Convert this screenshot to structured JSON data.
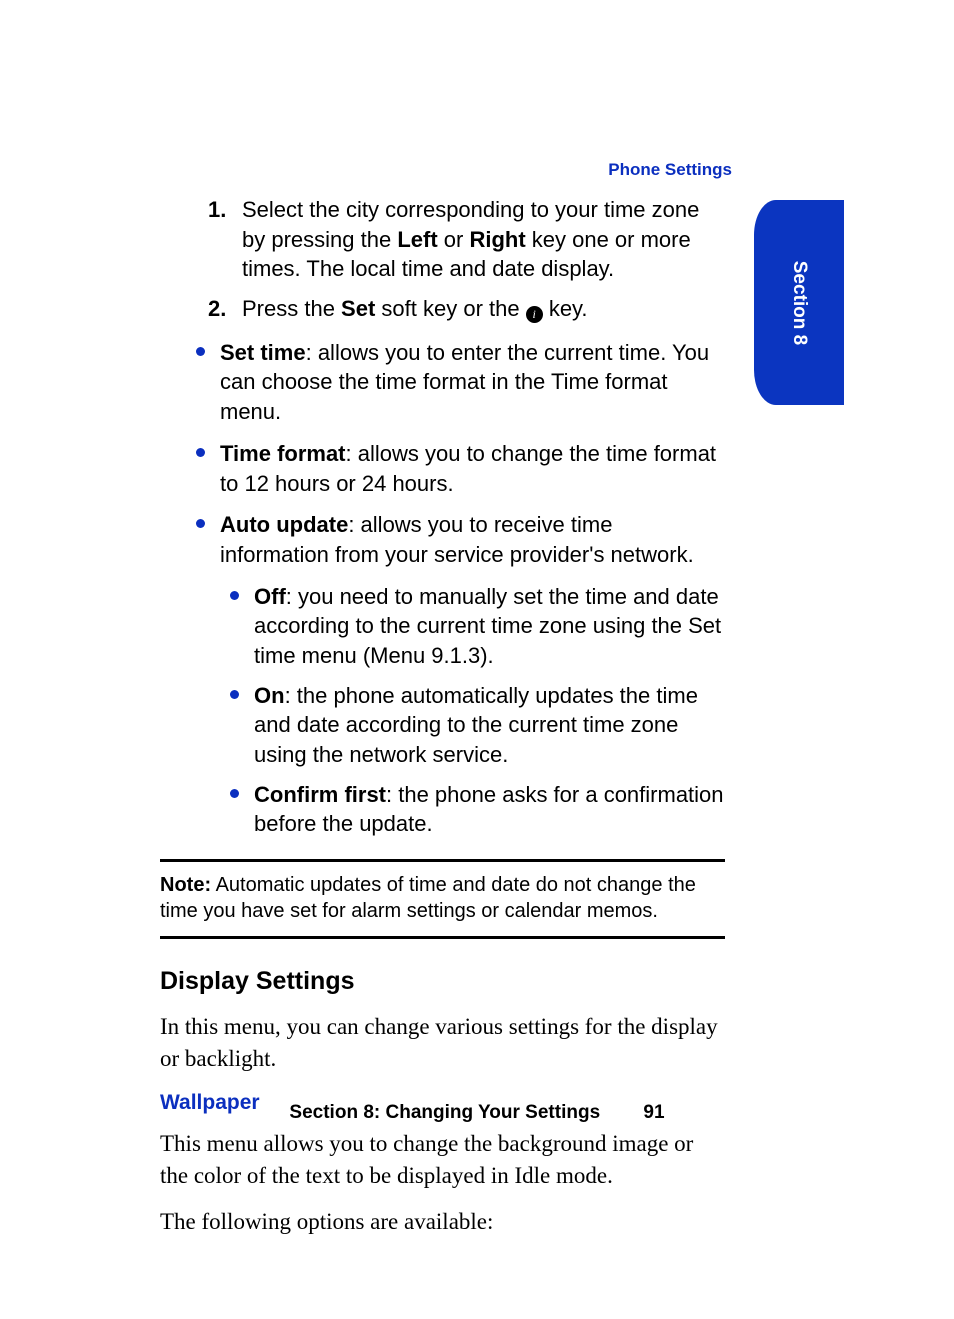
{
  "header": {
    "running_title": "Phone Settings"
  },
  "tab": {
    "label": "Section 8"
  },
  "steps": [
    {
      "marker": "1.",
      "pre": "Select the city corresponding to your time zone by pressing the ",
      "bold1": "Left",
      "mid": " or ",
      "bold2": "Right",
      "post": " key one or more times. The local time and date display."
    },
    {
      "marker": "2.",
      "pre": "Press the ",
      "bold1": "Set",
      "mid": " soft key or the ",
      "icon": "i",
      "post": " key."
    }
  ],
  "bullets": [
    {
      "bold": "Set time",
      "text": ": allows you to enter the current time. You can choose the time format in the Time format menu."
    },
    {
      "bold": "Time format",
      "text": ": allows you to change the time format to 12 hours or 24 hours."
    },
    {
      "bold": "Auto update",
      "text": ": allows you to receive time information from your service provider's network.",
      "sub": [
        {
          "bold": "Off",
          "text": ": you need to manually set the time and date according to the current time zone using the Set time menu (Menu 9.1.3)."
        },
        {
          "bold": "On",
          "text": ": the phone automatically updates the time and date according to the current time zone using the network service."
        },
        {
          "bold": "Confirm first",
          "text": ": the phone asks for a confirmation before the update."
        }
      ]
    }
  ],
  "note": {
    "label": "Note:",
    "text": " Automatic updates of time and date do not change the time you have set for alarm settings or calendar memos."
  },
  "section": {
    "heading": "Display Settings",
    "intro": "In this menu, you can change various settings for the display or backlight.",
    "sub_heading": "Wallpaper",
    "sub_p1": "This menu allows you to change the background image or the color of the text to be displayed in Idle mode.",
    "sub_p2": "The following options are available:"
  },
  "footer": {
    "section_label": "Section 8: Changing Your Settings",
    "page": "91"
  }
}
